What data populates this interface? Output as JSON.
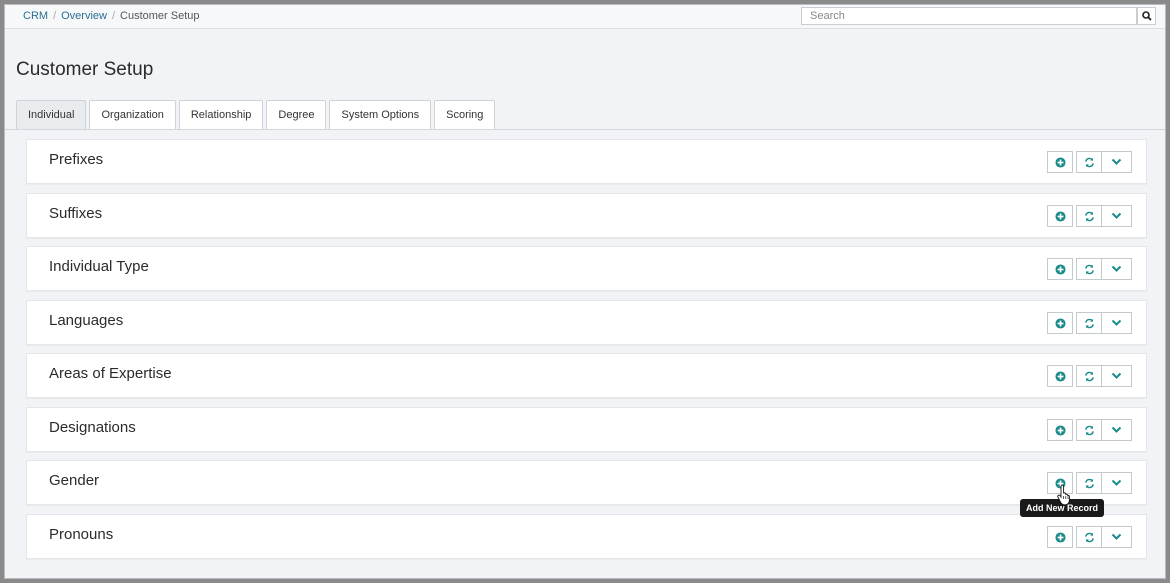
{
  "breadcrumb": {
    "items": [
      "CRM",
      "Overview"
    ],
    "current": "Customer Setup"
  },
  "search": {
    "placeholder": "Search",
    "value": ""
  },
  "page_title": "Customer Setup",
  "tabs": [
    {
      "label": "Individual",
      "active": true
    },
    {
      "label": "Organization",
      "active": false
    },
    {
      "label": "Relationship",
      "active": false
    },
    {
      "label": "Degree",
      "active": false
    },
    {
      "label": "System Options",
      "active": false
    },
    {
      "label": "Scoring",
      "active": false
    }
  ],
  "panels": [
    {
      "title": "Prefixes"
    },
    {
      "title": "Suffixes"
    },
    {
      "title": "Individual Type"
    },
    {
      "title": "Languages"
    },
    {
      "title": "Areas of Expertise"
    },
    {
      "title": "Designations"
    },
    {
      "title": "Gender"
    },
    {
      "title": "Pronouns"
    }
  ],
  "tooltip": {
    "text": "Add New Record"
  },
  "icons": {
    "add": "plus-circle-icon",
    "refresh": "refresh-icon",
    "collapse": "chevron-down-icon",
    "search": "search-icon"
  },
  "colors": {
    "accent": "#1a8a8a",
    "link": "#2a6f8f",
    "background": "#f1f3f6"
  }
}
